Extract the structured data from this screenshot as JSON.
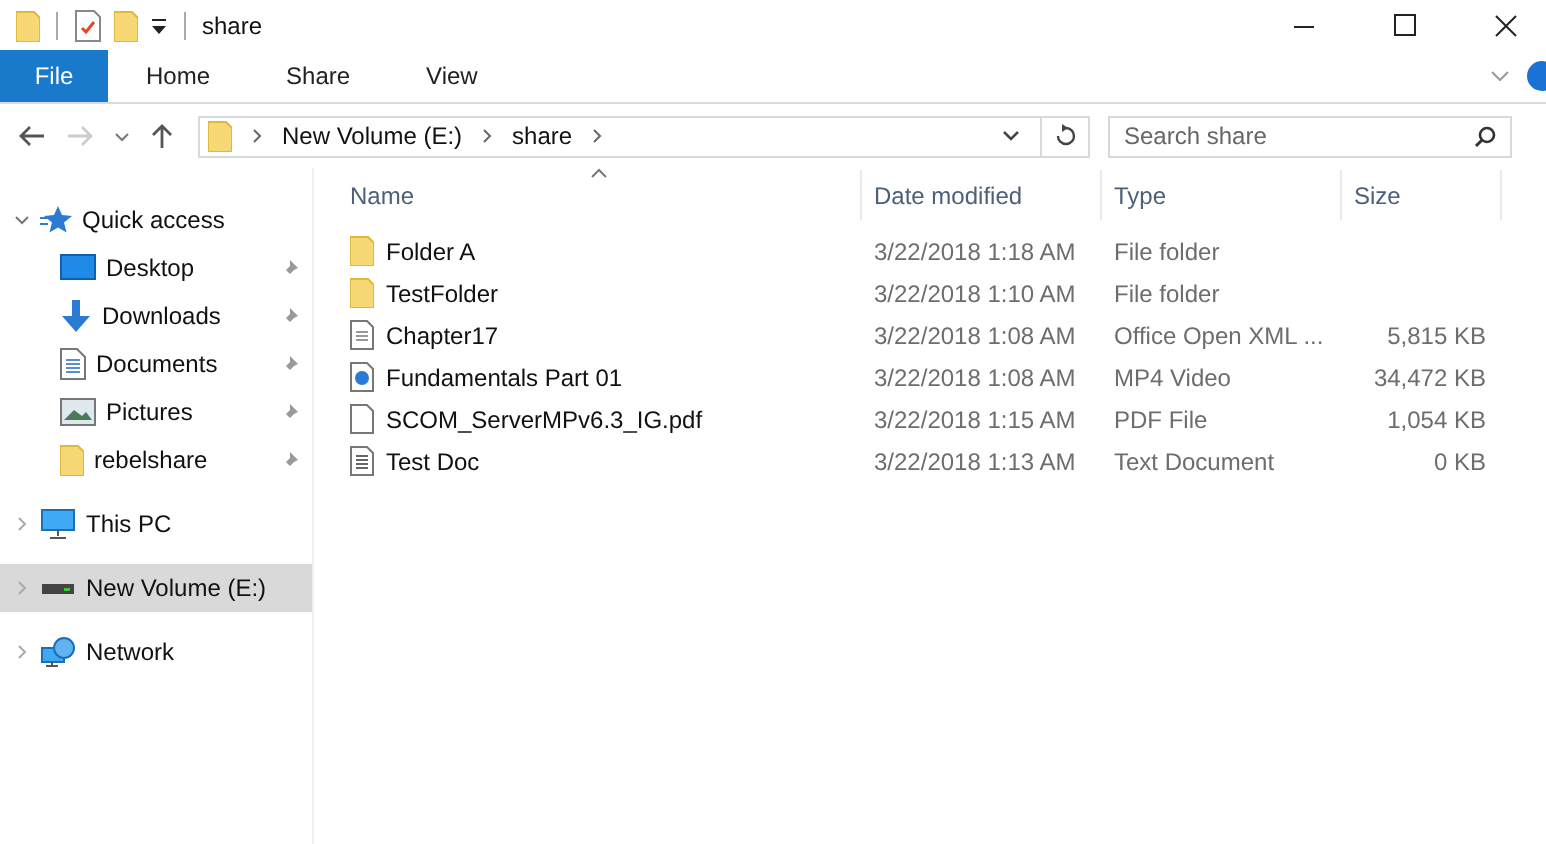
{
  "window": {
    "title": "share"
  },
  "tabs": [
    {
      "label": "File",
      "selected": true
    },
    {
      "label": "Home",
      "selected": false
    },
    {
      "label": "Share",
      "selected": false
    },
    {
      "label": "View",
      "selected": false
    }
  ],
  "address": {
    "segments": [
      "New Volume (E:)",
      "share"
    ]
  },
  "search": {
    "placeholder": "Search share"
  },
  "sidebar": {
    "items": [
      {
        "label": "Quick access",
        "kind": "star",
        "expanded": true,
        "selected": false,
        "children": [
          {
            "label": "Desktop",
            "kind": "desktop",
            "pinned": true
          },
          {
            "label": "Downloads",
            "kind": "download",
            "pinned": true
          },
          {
            "label": "Documents",
            "kind": "documents",
            "pinned": true
          },
          {
            "label": "Pictures",
            "kind": "pictures",
            "pinned": true
          },
          {
            "label": "rebelshare",
            "kind": "folder",
            "pinned": true
          }
        ]
      },
      {
        "label": "This PC",
        "kind": "pc",
        "expanded": false,
        "selected": false
      },
      {
        "label": "New Volume (E:)",
        "kind": "drive",
        "expanded": false,
        "selected": true
      },
      {
        "label": "Network",
        "kind": "network",
        "expanded": false,
        "selected": false
      }
    ]
  },
  "table": {
    "columns": [
      "Name",
      "Date modified",
      "Type",
      "Size"
    ],
    "rows": [
      {
        "kind": "folder",
        "name": "Folder A",
        "date": "3/22/2018 1:18 AM",
        "type": "File folder",
        "size": ""
      },
      {
        "kind": "folder",
        "name": "TestFolder",
        "date": "3/22/2018 1:10 AM",
        "type": "File folder",
        "size": ""
      },
      {
        "kind": "doc",
        "name": "Chapter17",
        "date": "3/22/2018 1:08 AM",
        "type": "Office Open XML ...",
        "size": "5,815 KB"
      },
      {
        "kind": "video",
        "name": "Fundamentals Part 01",
        "date": "3/22/2018 1:08 AM",
        "type": "MP4 Video",
        "size": "34,472 KB"
      },
      {
        "kind": "pdf",
        "name": "SCOM_ServerMPv6.3_IG.pdf",
        "date": "3/22/2018 1:15 AM",
        "type": "PDF File",
        "size": "1,054 KB"
      },
      {
        "kind": "text",
        "name": "Test Doc",
        "date": "3/22/2018 1:13 AM",
        "type": "Text Document",
        "size": "0 KB"
      }
    ]
  }
}
